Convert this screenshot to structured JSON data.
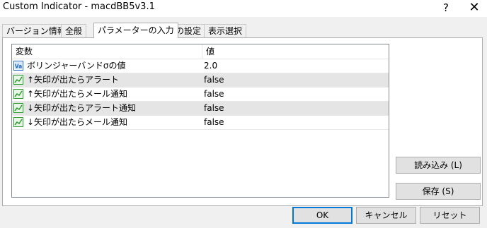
{
  "window": {
    "title": "Custom Indicator - macdBB5v3.1",
    "help_label": "?",
    "close_label": "✕"
  },
  "tabs": [
    {
      "label": "バージョン情報"
    },
    {
      "label": "全般"
    },
    {
      "label": "パラメーターの入力"
    },
    {
      "label": "色の設定"
    },
    {
      "label": "表示選択"
    }
  ],
  "table": {
    "columns": [
      "変数",
      "値"
    ],
    "rows": [
      {
        "icon": "value-icon",
        "name": "ボリンジャーバンドσの値",
        "value": "2.0"
      },
      {
        "icon": "chart-icon",
        "name": "↑矢印が出たらアラート",
        "value": "false"
      },
      {
        "icon": "chart-icon",
        "name": "↑矢印が出たらメール通知",
        "value": "false"
      },
      {
        "icon": "chart-icon",
        "name": "↓矢印が出たらアラート通知",
        "value": "false"
      },
      {
        "icon": "chart-icon",
        "name": "↓矢印が出たらメール通知",
        "value": "false"
      }
    ]
  },
  "side_buttons": {
    "load": "読み込み (L)",
    "save": "保存 (S)"
  },
  "footer_buttons": {
    "ok": "OK",
    "cancel": "キャンセル",
    "reset": "リセット"
  },
  "colors": {
    "dialog_bg": "#f0f0f0",
    "selected_row_bg": "#e5e5e5",
    "icon_green": "#2f9c2f",
    "icon_blue": "#2067c0",
    "default_button_border": "#0078d7"
  }
}
